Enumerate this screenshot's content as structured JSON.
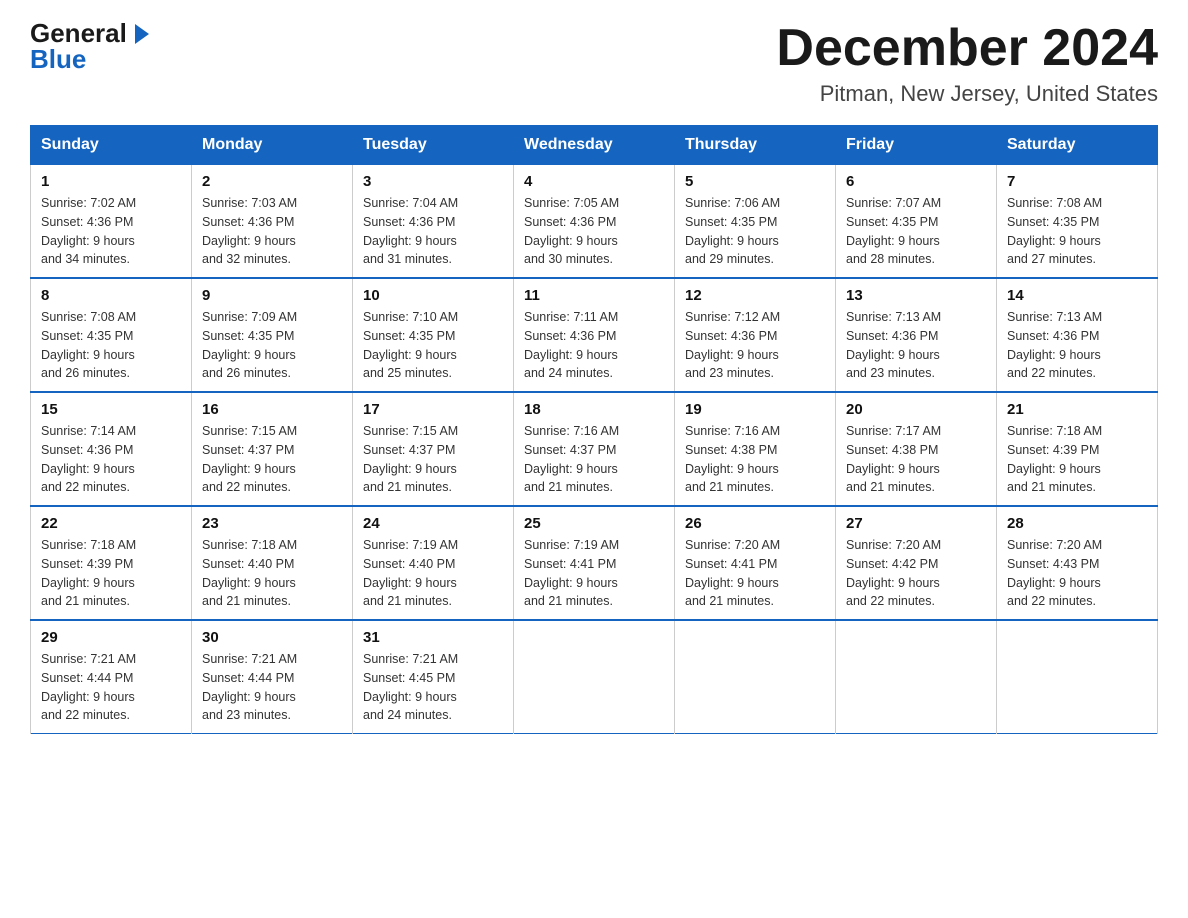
{
  "header": {
    "logo": {
      "general": "General",
      "blue": "Blue",
      "triangle": true
    },
    "month": "December 2024",
    "location": "Pitman, New Jersey, United States"
  },
  "days_of_week": [
    "Sunday",
    "Monday",
    "Tuesday",
    "Wednesday",
    "Thursday",
    "Friday",
    "Saturday"
  ],
  "weeks": [
    [
      {
        "day": "1",
        "sunrise": "7:02 AM",
        "sunset": "4:36 PM",
        "daylight": "9 hours and 34 minutes."
      },
      {
        "day": "2",
        "sunrise": "7:03 AM",
        "sunset": "4:36 PM",
        "daylight": "9 hours and 32 minutes."
      },
      {
        "day": "3",
        "sunrise": "7:04 AM",
        "sunset": "4:36 PM",
        "daylight": "9 hours and 31 minutes."
      },
      {
        "day": "4",
        "sunrise": "7:05 AM",
        "sunset": "4:36 PM",
        "daylight": "9 hours and 30 minutes."
      },
      {
        "day": "5",
        "sunrise": "7:06 AM",
        "sunset": "4:35 PM",
        "daylight": "9 hours and 29 minutes."
      },
      {
        "day": "6",
        "sunrise": "7:07 AM",
        "sunset": "4:35 PM",
        "daylight": "9 hours and 28 minutes."
      },
      {
        "day": "7",
        "sunrise": "7:08 AM",
        "sunset": "4:35 PM",
        "daylight": "9 hours and 27 minutes."
      }
    ],
    [
      {
        "day": "8",
        "sunrise": "7:08 AM",
        "sunset": "4:35 PM",
        "daylight": "9 hours and 26 minutes."
      },
      {
        "day": "9",
        "sunrise": "7:09 AM",
        "sunset": "4:35 PM",
        "daylight": "9 hours and 26 minutes."
      },
      {
        "day": "10",
        "sunrise": "7:10 AM",
        "sunset": "4:35 PM",
        "daylight": "9 hours and 25 minutes."
      },
      {
        "day": "11",
        "sunrise": "7:11 AM",
        "sunset": "4:36 PM",
        "daylight": "9 hours and 24 minutes."
      },
      {
        "day": "12",
        "sunrise": "7:12 AM",
        "sunset": "4:36 PM",
        "daylight": "9 hours and 23 minutes."
      },
      {
        "day": "13",
        "sunrise": "7:13 AM",
        "sunset": "4:36 PM",
        "daylight": "9 hours and 23 minutes."
      },
      {
        "day": "14",
        "sunrise": "7:13 AM",
        "sunset": "4:36 PM",
        "daylight": "9 hours and 22 minutes."
      }
    ],
    [
      {
        "day": "15",
        "sunrise": "7:14 AM",
        "sunset": "4:36 PM",
        "daylight": "9 hours and 22 minutes."
      },
      {
        "day": "16",
        "sunrise": "7:15 AM",
        "sunset": "4:37 PM",
        "daylight": "9 hours and 22 minutes."
      },
      {
        "day": "17",
        "sunrise": "7:15 AM",
        "sunset": "4:37 PM",
        "daylight": "9 hours and 21 minutes."
      },
      {
        "day": "18",
        "sunrise": "7:16 AM",
        "sunset": "4:37 PM",
        "daylight": "9 hours and 21 minutes."
      },
      {
        "day": "19",
        "sunrise": "7:16 AM",
        "sunset": "4:38 PM",
        "daylight": "9 hours and 21 minutes."
      },
      {
        "day": "20",
        "sunrise": "7:17 AM",
        "sunset": "4:38 PM",
        "daylight": "9 hours and 21 minutes."
      },
      {
        "day": "21",
        "sunrise": "7:18 AM",
        "sunset": "4:39 PM",
        "daylight": "9 hours and 21 minutes."
      }
    ],
    [
      {
        "day": "22",
        "sunrise": "7:18 AM",
        "sunset": "4:39 PM",
        "daylight": "9 hours and 21 minutes."
      },
      {
        "day": "23",
        "sunrise": "7:18 AM",
        "sunset": "4:40 PM",
        "daylight": "9 hours and 21 minutes."
      },
      {
        "day": "24",
        "sunrise": "7:19 AM",
        "sunset": "4:40 PM",
        "daylight": "9 hours and 21 minutes."
      },
      {
        "day": "25",
        "sunrise": "7:19 AM",
        "sunset": "4:41 PM",
        "daylight": "9 hours and 21 minutes."
      },
      {
        "day": "26",
        "sunrise": "7:20 AM",
        "sunset": "4:41 PM",
        "daylight": "9 hours and 21 minutes."
      },
      {
        "day": "27",
        "sunrise": "7:20 AM",
        "sunset": "4:42 PM",
        "daylight": "9 hours and 22 minutes."
      },
      {
        "day": "28",
        "sunrise": "7:20 AM",
        "sunset": "4:43 PM",
        "daylight": "9 hours and 22 minutes."
      }
    ],
    [
      {
        "day": "29",
        "sunrise": "7:21 AM",
        "sunset": "4:44 PM",
        "daylight": "9 hours and 22 minutes."
      },
      {
        "day": "30",
        "sunrise": "7:21 AM",
        "sunset": "4:44 PM",
        "daylight": "9 hours and 23 minutes."
      },
      {
        "day": "31",
        "sunrise": "7:21 AM",
        "sunset": "4:45 PM",
        "daylight": "9 hours and 24 minutes."
      },
      null,
      null,
      null,
      null
    ]
  ],
  "labels": {
    "sunrise": "Sunrise:",
    "sunset": "Sunset:",
    "daylight": "Daylight:"
  }
}
